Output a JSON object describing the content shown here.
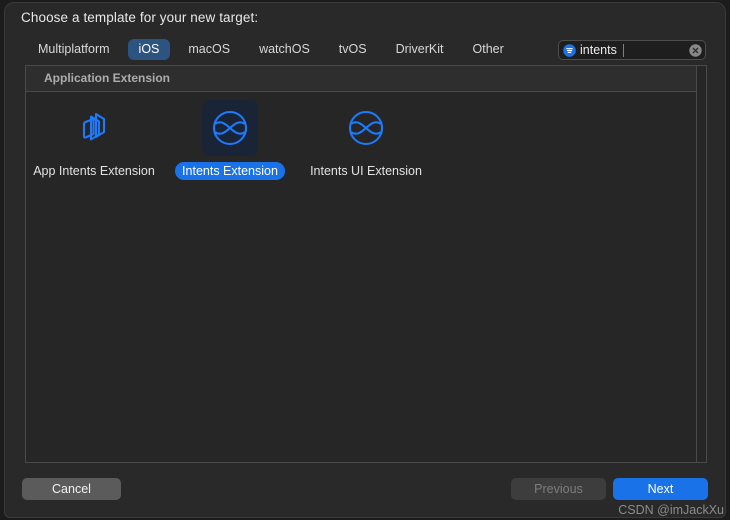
{
  "dialog": {
    "title": "Choose a template for your new target:"
  },
  "platform_tabs": [
    {
      "label": "Multiplatform",
      "selected": false
    },
    {
      "label": "iOS",
      "selected": true
    },
    {
      "label": "macOS",
      "selected": false
    },
    {
      "label": "watchOS",
      "selected": false
    },
    {
      "label": "tvOS",
      "selected": false
    },
    {
      "label": "DriverKit",
      "selected": false
    },
    {
      "label": "Other",
      "selected": false
    }
  ],
  "search": {
    "value": "intents",
    "placeholder": "Filter",
    "filter_icon": "filter-circle-icon",
    "clear_icon": "clear-circle-icon"
  },
  "content": {
    "section_header": "Application Extension",
    "templates": [
      {
        "label": "App Intents Extension",
        "icon": "app-intents-layers-icon",
        "selected": false
      },
      {
        "label": "Intents Extension",
        "icon": "intents-circle-wave-icon",
        "selected": true
      },
      {
        "label": "Intents UI Extension",
        "icon": "intents-circle-wave-icon",
        "selected": false
      }
    ]
  },
  "footer": {
    "cancel_label": "Cancel",
    "previous_label": "Previous",
    "next_label": "Next"
  },
  "watermark": {
    "text": "CSDN @imJackXu"
  },
  "colors": {
    "accent_blue": "#1a72e8",
    "icon_blue": "#1d7afc",
    "tab_selected": "#2d5380",
    "window_bg": "#292929",
    "panel_bg": "#262626"
  }
}
